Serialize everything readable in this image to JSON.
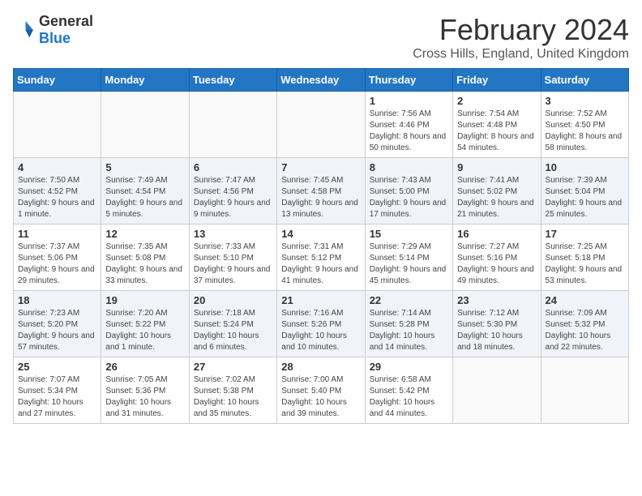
{
  "logo": {
    "text_general": "General",
    "text_blue": "Blue",
    "icon_title": "GeneralBlue logo"
  },
  "title": "February 2024",
  "subtitle": "Cross Hills, England, United Kingdom",
  "weekdays": [
    "Sunday",
    "Monday",
    "Tuesday",
    "Wednesday",
    "Thursday",
    "Friday",
    "Saturday"
  ],
  "weeks": [
    [
      {
        "day": "",
        "empty": true
      },
      {
        "day": "",
        "empty": true
      },
      {
        "day": "",
        "empty": true
      },
      {
        "day": "",
        "empty": true
      },
      {
        "day": "1",
        "sunrise": "7:56 AM",
        "sunset": "4:46 PM",
        "daylight": "8 hours and 50 minutes."
      },
      {
        "day": "2",
        "sunrise": "7:54 AM",
        "sunset": "4:48 PM",
        "daylight": "8 hours and 54 minutes."
      },
      {
        "day": "3",
        "sunrise": "7:52 AM",
        "sunset": "4:50 PM",
        "daylight": "8 hours and 58 minutes."
      }
    ],
    [
      {
        "day": "4",
        "sunrise": "7:50 AM",
        "sunset": "4:52 PM",
        "daylight": "9 hours and 1 minute."
      },
      {
        "day": "5",
        "sunrise": "7:49 AM",
        "sunset": "4:54 PM",
        "daylight": "9 hours and 5 minutes."
      },
      {
        "day": "6",
        "sunrise": "7:47 AM",
        "sunset": "4:56 PM",
        "daylight": "9 hours and 9 minutes."
      },
      {
        "day": "7",
        "sunrise": "7:45 AM",
        "sunset": "4:58 PM",
        "daylight": "9 hours and 13 minutes."
      },
      {
        "day": "8",
        "sunrise": "7:43 AM",
        "sunset": "5:00 PM",
        "daylight": "9 hours and 17 minutes."
      },
      {
        "day": "9",
        "sunrise": "7:41 AM",
        "sunset": "5:02 PM",
        "daylight": "9 hours and 21 minutes."
      },
      {
        "day": "10",
        "sunrise": "7:39 AM",
        "sunset": "5:04 PM",
        "daylight": "9 hours and 25 minutes."
      }
    ],
    [
      {
        "day": "11",
        "sunrise": "7:37 AM",
        "sunset": "5:06 PM",
        "daylight": "9 hours and 29 minutes."
      },
      {
        "day": "12",
        "sunrise": "7:35 AM",
        "sunset": "5:08 PM",
        "daylight": "9 hours and 33 minutes."
      },
      {
        "day": "13",
        "sunrise": "7:33 AM",
        "sunset": "5:10 PM",
        "daylight": "9 hours and 37 minutes."
      },
      {
        "day": "14",
        "sunrise": "7:31 AM",
        "sunset": "5:12 PM",
        "daylight": "9 hours and 41 minutes."
      },
      {
        "day": "15",
        "sunrise": "7:29 AM",
        "sunset": "5:14 PM",
        "daylight": "9 hours and 45 minutes."
      },
      {
        "day": "16",
        "sunrise": "7:27 AM",
        "sunset": "5:16 PM",
        "daylight": "9 hours and 49 minutes."
      },
      {
        "day": "17",
        "sunrise": "7:25 AM",
        "sunset": "5:18 PM",
        "daylight": "9 hours and 53 minutes."
      }
    ],
    [
      {
        "day": "18",
        "sunrise": "7:23 AM",
        "sunset": "5:20 PM",
        "daylight": "9 hours and 57 minutes."
      },
      {
        "day": "19",
        "sunrise": "7:20 AM",
        "sunset": "5:22 PM",
        "daylight": "10 hours and 1 minute."
      },
      {
        "day": "20",
        "sunrise": "7:18 AM",
        "sunset": "5:24 PM",
        "daylight": "10 hours and 6 minutes."
      },
      {
        "day": "21",
        "sunrise": "7:16 AM",
        "sunset": "5:26 PM",
        "daylight": "10 hours and 10 minutes."
      },
      {
        "day": "22",
        "sunrise": "7:14 AM",
        "sunset": "5:28 PM",
        "daylight": "10 hours and 14 minutes."
      },
      {
        "day": "23",
        "sunrise": "7:12 AM",
        "sunset": "5:30 PM",
        "daylight": "10 hours and 18 minutes."
      },
      {
        "day": "24",
        "sunrise": "7:09 AM",
        "sunset": "5:32 PM",
        "daylight": "10 hours and 22 minutes."
      }
    ],
    [
      {
        "day": "25",
        "sunrise": "7:07 AM",
        "sunset": "5:34 PM",
        "daylight": "10 hours and 27 minutes."
      },
      {
        "day": "26",
        "sunrise": "7:05 AM",
        "sunset": "5:36 PM",
        "daylight": "10 hours and 31 minutes."
      },
      {
        "day": "27",
        "sunrise": "7:02 AM",
        "sunset": "5:38 PM",
        "daylight": "10 hours and 35 minutes."
      },
      {
        "day": "28",
        "sunrise": "7:00 AM",
        "sunset": "5:40 PM",
        "daylight": "10 hours and 39 minutes."
      },
      {
        "day": "29",
        "sunrise": "6:58 AM",
        "sunset": "5:42 PM",
        "daylight": "10 hours and 44 minutes."
      },
      {
        "day": "",
        "empty": true
      },
      {
        "day": "",
        "empty": true
      }
    ]
  ],
  "labels": {
    "sunrise": "Sunrise:",
    "sunset": "Sunset:",
    "daylight": "Daylight:"
  }
}
